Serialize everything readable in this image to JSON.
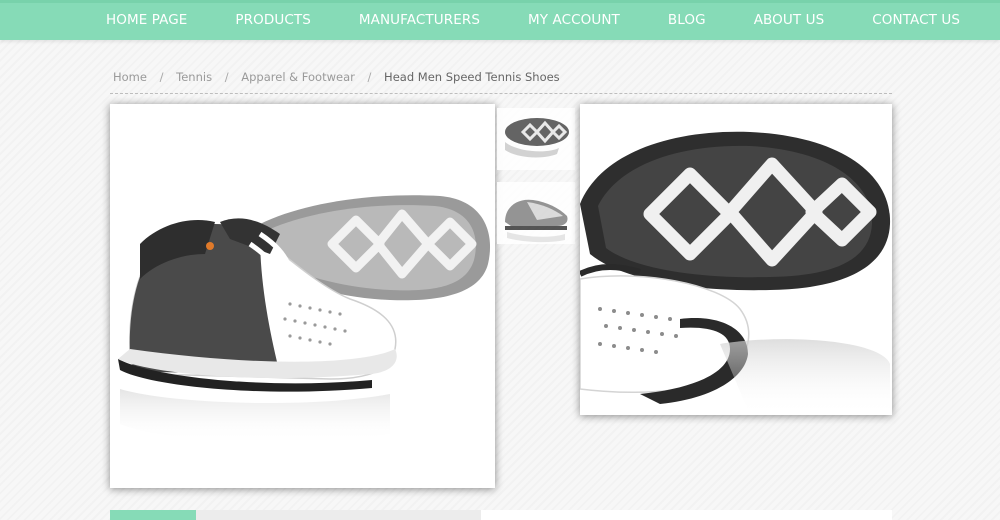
{
  "nav": {
    "items": [
      "HOME PAGE",
      "PRODUCTS",
      "MANUFACTURERS",
      "MY ACCOUNT",
      "BLOG",
      "ABOUT US",
      "CONTACT US"
    ]
  },
  "breadcrumb": {
    "items": [
      "Home",
      "Tennis",
      "Apparel & Footwear"
    ],
    "current": "Head Men Speed Tennis Shoes",
    "separator": "/"
  },
  "product": {
    "main_image": "tennis-shoe-pair-image",
    "thumbnails": [
      "shoe-sole-thumbnail",
      "shoe-side-thumbnail"
    ],
    "zoom_image": "shoe-sole-zoom-image"
  },
  "colors": {
    "accent": "#86dbb7"
  }
}
